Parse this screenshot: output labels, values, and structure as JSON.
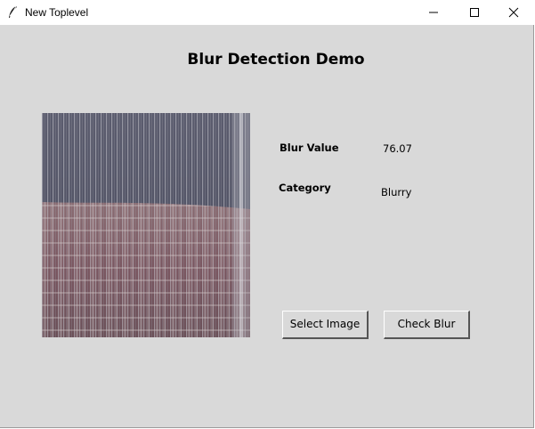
{
  "window": {
    "title": "New Toplevel",
    "title_icon": "feather-icon",
    "controls": [
      "minimize-icon",
      "maximize-icon",
      "close-icon"
    ]
  },
  "heading": "Blur Detection Demo",
  "image": {
    "description_icon": "image-preview"
  },
  "results": {
    "blur_label": "Blur Value",
    "blur_value": "76.07",
    "category_label": "Category",
    "category_value": "Blurry"
  },
  "buttons": {
    "select_label": "Select Image",
    "check_label": "Check Blur"
  },
  "colors": {
    "background": "#d9d9d9",
    "titlebar": "#ffffff"
  }
}
